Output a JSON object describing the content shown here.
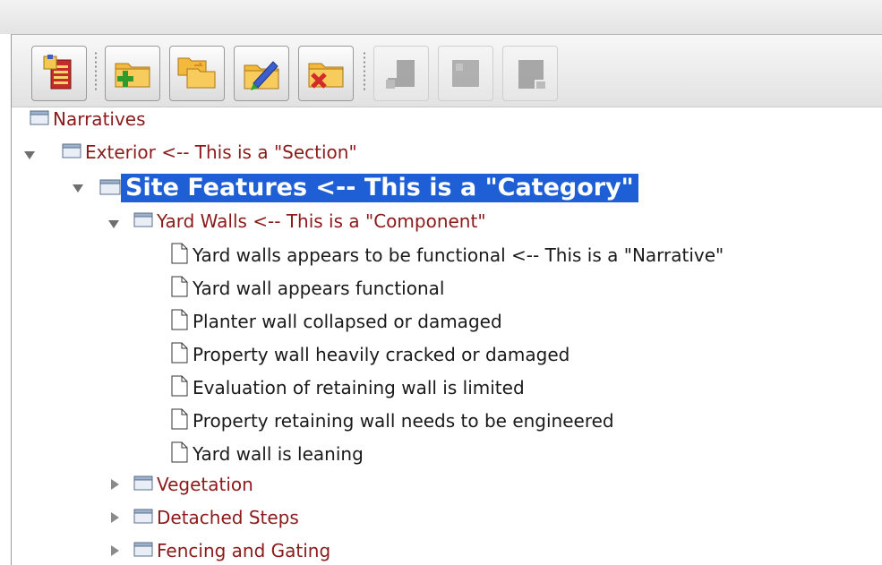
{
  "toolbar": {
    "buttons": [
      {
        "name": "narratives-button",
        "icon": "clipboard-icon",
        "enabled": true
      },
      {
        "name": "add-folder-button",
        "icon": "folder-add-icon",
        "enabled": true
      },
      {
        "name": "duplicate-folder-button",
        "icon": "folders-icon",
        "enabled": true
      },
      {
        "name": "edit-folder-button",
        "icon": "folder-edit-icon",
        "enabled": true
      },
      {
        "name": "delete-folder-button",
        "icon": "folder-delete-icon",
        "enabled": true
      },
      {
        "name": "disabled-button-1",
        "icon": "disabled-icon",
        "enabled": false
      },
      {
        "name": "disabled-button-2",
        "icon": "disabled-icon",
        "enabled": false
      },
      {
        "name": "disabled-button-3",
        "icon": "disabled-icon",
        "enabled": false
      }
    ]
  },
  "tree": {
    "root": "Narratives",
    "section": "Exterior  <-- This is a \"Section\"",
    "category": "Site Features  <-- This is a \"Category\"",
    "component": "Yard Walls  <-- This is a \"Component\"",
    "narratives": [
      "Yard walls appears to be functional  <-- This is a \"Narrative\"",
      "Yard wall appears functional",
      "Planter wall collapsed or damaged",
      "Property wall heavily cracked or damaged",
      "Evaluation of retaining wall is limited",
      "Property retaining wall needs to be engineered",
      "Yard wall is leaning"
    ],
    "collapsed_components": [
      "Vegetation",
      "Detached Steps",
      "Fencing and Gating"
    ]
  },
  "colors": {
    "selection": "#1f5fd6",
    "folder_label": "#8b1a1a"
  }
}
